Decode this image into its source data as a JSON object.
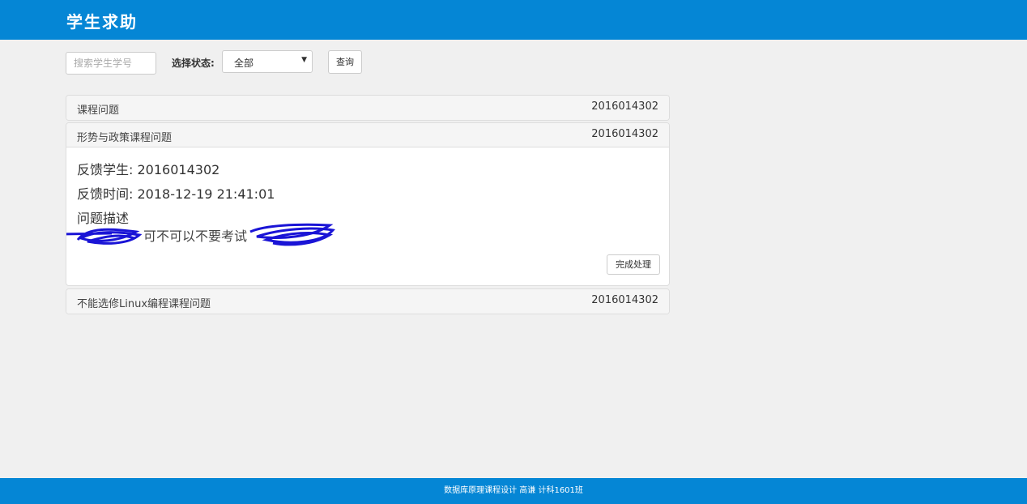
{
  "app": {
    "title": "学生求助"
  },
  "filters": {
    "search_placeholder": "搜索学生学号",
    "status_label": "选择状态:",
    "status_selected": "全部",
    "query_label": "查询"
  },
  "requests": [
    {
      "title": "课程问题",
      "student_id": "2016014302",
      "expanded": false
    },
    {
      "title": "形势与政策课程问题",
      "student_id": "2016014302",
      "expanded": true,
      "detail": {
        "student_label": "反馈学生:",
        "student_value": "2016014302",
        "time_label": "反馈时间:",
        "time_value": "2018-12-19 21:41:01",
        "desc_label": "问题描述",
        "desc_text": "可不可以不要考试",
        "complete_label": "完成处理"
      }
    },
    {
      "title": "不能选修Linux编程课程问题",
      "student_id": "2016014302",
      "expanded": false
    }
  ],
  "footer": {
    "text": "数据库原理课程设计 高谦 计科1601班"
  },
  "colors": {
    "brand": "#0586d5",
    "scribble": "#1a14d6"
  }
}
